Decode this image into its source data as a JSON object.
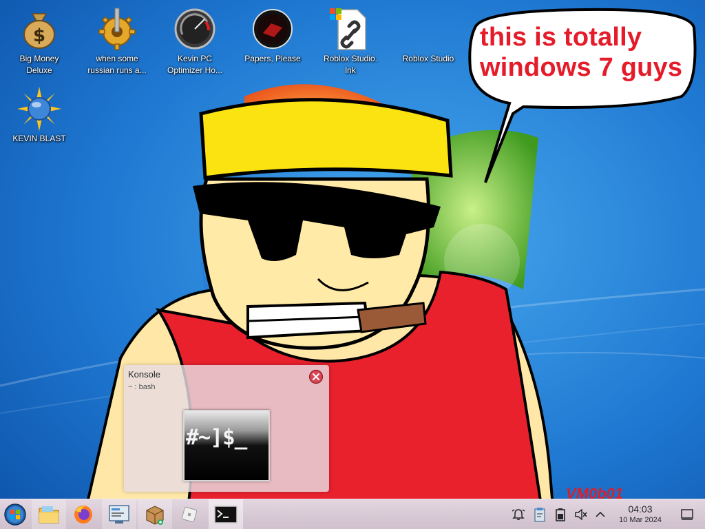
{
  "desktop": {
    "icons": [
      {
        "id": "big-money",
        "label": "Big Money\nDeluxe"
      },
      {
        "id": "russian",
        "label": "when some\nrussian runs a..."
      },
      {
        "id": "kevin-optimizer",
        "label": "Kevin PC\nOptimizer Ho..."
      },
      {
        "id": "papers-please",
        "label": "Papers, Please"
      },
      {
        "id": "roblox-lnk",
        "label": "Roblox Studio.\nlnk"
      },
      {
        "id": "roblox-studio",
        "label": "Roblox Studio"
      },
      {
        "id": "kevin-blast",
        "label": "KEVIN BLAST"
      }
    ]
  },
  "wallpaper": {
    "speech_bubble": "this is totally windows 7 guys",
    "signature": "VM0b01"
  },
  "task_preview": {
    "title": "Konsole",
    "subtitle": "~ : bash",
    "thumbnail_text": "#~]$_"
  },
  "taskbar": {
    "start_icon": "start-orb-icon",
    "buttons": [
      {
        "name": "file-manager-icon"
      },
      {
        "name": "firefox-icon"
      },
      {
        "name": "system-settings-icon"
      },
      {
        "name": "package-installer-icon"
      },
      {
        "name": "roblox-icon"
      },
      {
        "name": "konsole-icon"
      }
    ],
    "tray": [
      {
        "name": "notifications-icon"
      },
      {
        "name": "clipboard-icon"
      },
      {
        "name": "battery-icon"
      },
      {
        "name": "volume-muted-icon"
      },
      {
        "name": "expand-tray-icon"
      }
    ],
    "clock": {
      "time": "04:03",
      "date": "10 Mar 2024"
    },
    "show_desktop": "show-desktop-icon"
  },
  "colors": {
    "wallpaper_blue": "#1f78d1",
    "taskbar_bg": "#d9cbd6",
    "bubble_text": "#e51b2a",
    "close_red": "#da4453"
  }
}
